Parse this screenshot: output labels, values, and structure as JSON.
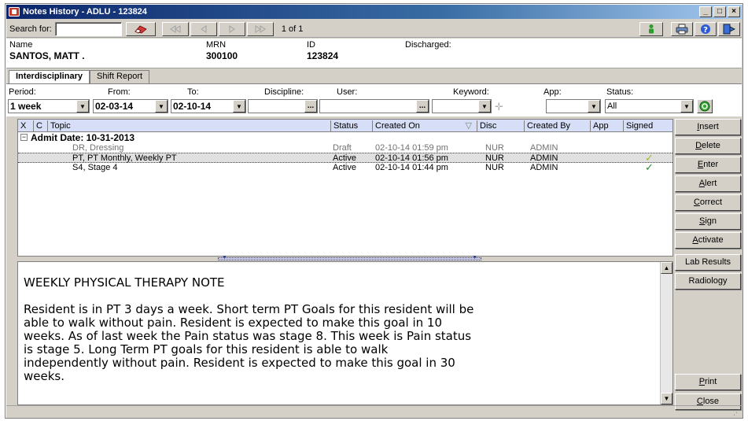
{
  "window": {
    "title": "Notes History - ADLU - 123824"
  },
  "toolbar": {
    "search_label": "Search for:",
    "search_value": "",
    "page_text": "1 of 1"
  },
  "header": {
    "name_label": "Name",
    "name_value": "SANTOS, MATT .",
    "mrn_label": "MRN",
    "mrn_value": "300100",
    "id_label": "ID",
    "id_value": "123824",
    "discharged_label": "Discharged:",
    "discharged_value": ""
  },
  "tabs": [
    {
      "label": "Interdisciplinary",
      "active": true
    },
    {
      "label": "Shift Report",
      "active": false
    }
  ],
  "filters": {
    "period_label": "Period:",
    "period_value": "1 week",
    "from_label": "From:",
    "from_value": "02-03-14",
    "to_label": "To:",
    "to_value": "02-10-14",
    "discipline_label": "Discipline:",
    "discipline_value": "",
    "user_label": "User:",
    "user_value": "",
    "keyword_label": "Keyword:",
    "keyword_value": "",
    "app_label": "App:",
    "app_value": "",
    "status_label": "Status:",
    "status_value": "All"
  },
  "grid": {
    "columns": {
      "x": "X",
      "c": "C",
      "topic": "Topic",
      "status": "Status",
      "created_on": "Created On",
      "disc": "Disc",
      "created_by": "Created By",
      "app": "App",
      "signed": "Signed"
    },
    "group": {
      "expander": "−",
      "label": "Admit Date: 10-31-2013"
    },
    "rows": [
      {
        "topic": "DR, Dressing",
        "status": "Draft",
        "created_on": "02-10-14 01:59 pm",
        "disc": "NUR",
        "created_by": "ADMIN",
        "signed": ""
      },
      {
        "topic": "PT, PT Monthly, Weekly PT",
        "status": "Active",
        "created_on": "02-10-14 01:56 pm",
        "disc": "NUR",
        "created_by": "ADMIN",
        "signed": "✓"
      },
      {
        "topic": "S4, Stage 4",
        "status": "Active",
        "created_on": "02-10-14 01:44 pm",
        "disc": "NUR",
        "created_by": "ADMIN",
        "signed": "✓"
      }
    ]
  },
  "note": {
    "title": "WEEKLY PHYSICAL THERAPY NOTE",
    "lines": [
      "Resident is in PT 3 days a week. Short term PT Goals for this resident will be",
      "able to walk without pain. Resident is expected to make this goal in 10",
      "weeks. As of last week the Pain status was stage 8. This week is Pain status",
      "is stage 5. Long Term PT goals for this resident is able to walk",
      "independently without pain. Resident is expected to make this goal in 30",
      "weeks."
    ]
  },
  "side_buttons": {
    "insert": "Insert",
    "delete": "Delete",
    "enter": "Enter",
    "alert": "Alert",
    "correct": "Correct",
    "sign": "Sign",
    "activate": "Activate",
    "lab_results": "Lab Results",
    "radiology": "Radiology",
    "print": "Print",
    "close": "Close"
  },
  "icons": {
    "clear_search": "eraser-icon",
    "first": "first-page-icon",
    "prev": "prev-page-icon",
    "next": "next-page-icon",
    "last": "last-page-icon",
    "flag": "green-person-icon",
    "print": "printer-icon",
    "help": "help-icon",
    "exit": "exit-icon",
    "refresh": "green-refresh-icon"
  },
  "colors": {
    "accent": "#0a246a",
    "grid_header": "#d6dff7",
    "signed_check": "#2e8b2e"
  }
}
